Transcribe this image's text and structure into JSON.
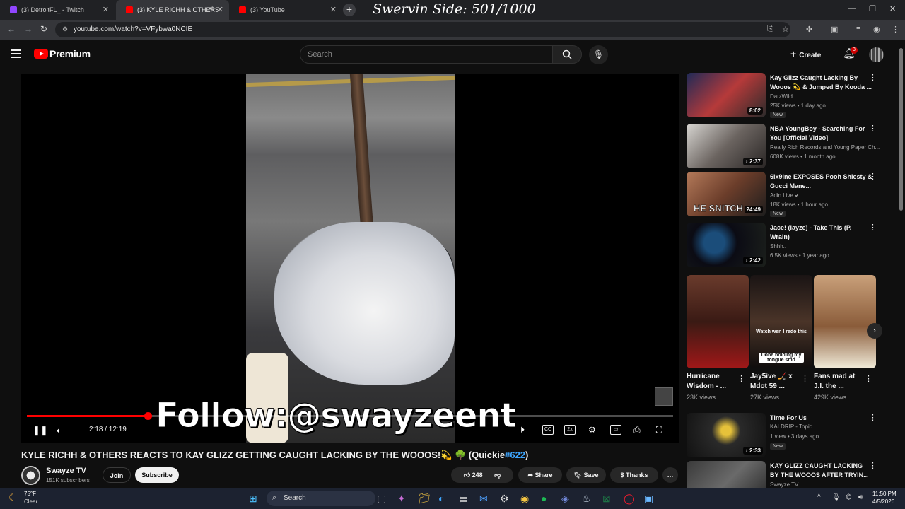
{
  "browser": {
    "tabs": [
      {
        "label": "(3) DetroitFL_ - Twitch",
        "favicon_color": "#9146ff"
      },
      {
        "label": "(3) KYLE RICHH & OTHERS",
        "favicon_color": "#ff0000"
      },
      {
        "label": "(3) YouTube",
        "favicon_color": "#ff0000"
      }
    ],
    "overlay_title": "Swervin Side: 501/1000",
    "url": "youtube.com/watch?v=VFybwa0NCIE"
  },
  "header": {
    "logo_text": "Premium",
    "search_placeholder": "Search",
    "create_label": "Create",
    "notifications_count": "3"
  },
  "player": {
    "overlay_text": "Follow:@swayzeent",
    "time_current": "2:18",
    "time_total": "12:19",
    "timecode": "2:18 / 12:19",
    "progress_fraction": 0.187,
    "speed_label": "2x",
    "hd_badge": "HD"
  },
  "video": {
    "title": "KYLE RICHH & OTHERS REACTS TO KAY GLIZZ GETTING CAUGHT LACKING BY THE WOOOS!💫 🌳 (Quickie",
    "title_tag": "#622",
    "title_end": ")",
    "channel": "Swayze TV",
    "subscribers": "151K subscribers",
    "join_label": "Join",
    "subscribe_label": "Subscribe",
    "likes": "248",
    "share_label": "Share",
    "save_label": "Save",
    "thanks_label": "Thanks"
  },
  "sidebar": {
    "recommendations": [
      {
        "title": "Kay Glizz Caught Lacking By Wooos 💫 & Jumped By Kooda ...",
        "channel": "DatzWild",
        "meta": "25K views • 1 day ago",
        "badge": "New",
        "duration": "8:02"
      },
      {
        "title": "NBA YoungBoy - Searching For You [Official Video]",
        "channel": "Really Rich Records and Young Paper Ch...",
        "meta": "608K views • 1 month ago",
        "badge": "",
        "duration": "2:37"
      },
      {
        "title": "6ix9ine EXPOSES Pooh Shiesty & Gucci Mane...",
        "channel": "Adin Live ✔",
        "meta": "18K views • 1 hour ago",
        "badge": "New",
        "duration": "24:49",
        "thumb_text": "HE SNITCH"
      },
      {
        "title": "Jace! (iayze) - Take This (P. Wrain)",
        "channel": "Shhh..",
        "meta": "6.5K views • 1 year ago",
        "badge": "",
        "duration": "2:42"
      }
    ],
    "shorts": [
      {
        "title": "Hurricane Wisdom - ...",
        "views": "23K views"
      },
      {
        "title": "Jay5ive 🏒 x Mdot 59 ...",
        "views": "27K views",
        "caption1": "Watch wen I redo this",
        "caption2": "Done holding my tongue smd"
      },
      {
        "title": "Fans mad at J.I. the ...",
        "views": "429K views"
      }
    ],
    "more": [
      {
        "title": "Time For Us",
        "channel": "KAI DRIP - Topic",
        "meta": "1 view • 3 days ago",
        "badge": "New",
        "duration": "2:33"
      },
      {
        "title": "KAY GLIZZ CAUGHT LACKING BY THE WOOOS AFTER TRYIN...",
        "channel": "Swayze TV",
        "meta": "",
        "badge": "",
        "duration": ""
      }
    ]
  },
  "taskbar": {
    "temperature": "75°F",
    "weather": "Clear",
    "search_label": "Search",
    "time": "11:50 PM",
    "date": "4/5/2026"
  },
  "colors": {
    "accent": "#ff0000",
    "link": "#3ea6ff",
    "background": "#0f0f0f"
  }
}
